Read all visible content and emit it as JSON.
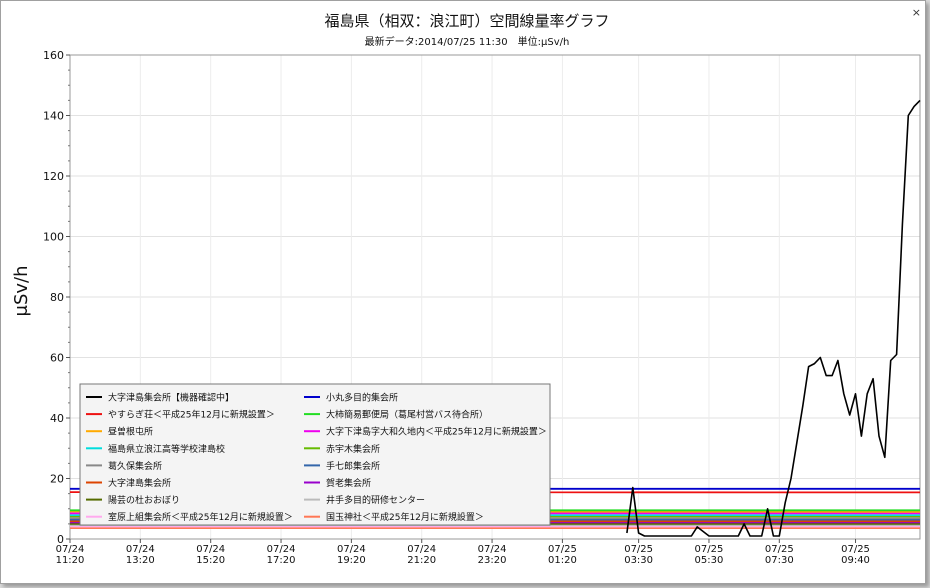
{
  "window": {
    "close_label": "×"
  },
  "chart_data": {
    "type": "line",
    "title": "福島県（相双：浪江町）空間線量率グラフ",
    "subtitle": "最新データ:2014/07/25 11:30　単位:μSv/h",
    "ylabel": "μSv/h",
    "ylim": [
      0,
      160
    ],
    "yticks": [
      0,
      20,
      40,
      60,
      80,
      100,
      120,
      140,
      160
    ],
    "xlim": [
      "07/24 11:20",
      "07/25 11:30"
    ],
    "xticks": [
      {
        "date": "07/24",
        "time": "11:20"
      },
      {
        "date": "07/24",
        "time": "13:20"
      },
      {
        "date": "07/24",
        "time": "15:20"
      },
      {
        "date": "07/24",
        "time": "17:20"
      },
      {
        "date": "07/24",
        "time": "19:20"
      },
      {
        "date": "07/24",
        "time": "21:20"
      },
      {
        "date": "07/24",
        "time": "23:20"
      },
      {
        "date": "07/25",
        "time": "01:20"
      },
      {
        "date": "07/25",
        "time": "03:30"
      },
      {
        "date": "07/25",
        "time": "05:30"
      },
      {
        "date": "07/25",
        "time": "07:30"
      },
      {
        "date": "07/25",
        "time": "09:40"
      }
    ],
    "grid": true,
    "legend_position": "bottom-left",
    "series": [
      {
        "name": "大字津島集会所【機器確認中】",
        "color": "#000000",
        "x": [
          "07/24 11:20",
          "07/25 02:40",
          "07/25 03:10",
          "07/25 03:20",
          "07/25 03:30",
          "07/25 03:40",
          "07/25 04:00",
          "07/25 04:40",
          "07/25 05:00",
          "07/25 05:10",
          "07/25 05:30",
          "07/25 06:00",
          "07/25 06:20",
          "07/25 06:30",
          "07/25 06:40",
          "07/25 07:00",
          "07/25 07:10",
          "07/25 07:20",
          "07/25 07:30",
          "07/25 07:40",
          "07/25 07:50",
          "07/25 08:00",
          "07/25 08:10",
          "07/25 08:20",
          "07/25 08:30",
          "07/25 08:40",
          "07/25 08:50",
          "07/25 09:00",
          "07/25 09:10",
          "07/25 09:20",
          "07/25 09:30",
          "07/25 09:40",
          "07/25 09:50",
          "07/25 10:00",
          "07/25 10:10",
          "07/25 10:20",
          "07/25 10:30",
          "07/25 10:40",
          "07/25 10:50",
          "07/25 11:00",
          "07/25 11:10",
          "07/25 11:20",
          "07/25 11:30"
        ],
        "values": [
          null,
          null,
          2,
          17,
          2,
          1,
          1,
          1,
          1,
          4,
          1,
          1,
          1,
          5,
          1,
          1,
          10,
          1,
          1,
          12,
          20,
          32,
          44,
          57,
          58,
          60,
          54,
          54,
          59,
          48,
          41,
          48,
          34,
          48,
          53,
          34,
          27,
          59,
          61,
          104,
          140,
          143,
          145
        ]
      },
      {
        "name": "小丸多目的集会所",
        "color": "#0000cc",
        "x": [
          "07/24 11:20",
          "07/25 11:30"
        ],
        "values": [
          16.6,
          16.6
        ]
      },
      {
        "name": "やすらぎ荘＜平成25年12月に新規設置＞",
        "color": "#ee1111",
        "x": [
          "07/24 11:20",
          "07/25 11:30"
        ],
        "values": [
          15.5,
          15.4
        ]
      },
      {
        "name": "大柿簡易郵便局（葛尾村営バス待合所）",
        "color": "#22dd22",
        "x": [
          "07/24 11:20",
          "07/25 11:30"
        ],
        "values": [
          9.5,
          9.5
        ]
      },
      {
        "name": "昼曽根屯所",
        "color": "#ffaa00",
        "x": [
          "07/24 11:20",
          "07/25 11:30"
        ],
        "values": [
          9.1,
          9.0
        ]
      },
      {
        "name": "大字下津島字大和久地内＜平成25年12月に新規設置＞",
        "color": "#ee00ee",
        "x": [
          "07/24 11:20",
          "07/25 11:30"
        ],
        "values": [
          8.5,
          8.5
        ]
      },
      {
        "name": "福島県立浪江高等学校津島校",
        "color": "#00dddd",
        "x": [
          "07/24 11:20",
          "07/25 11:30"
        ],
        "values": [
          7.9,
          7.9
        ]
      },
      {
        "name": "赤宇木集会所",
        "color": "#66bb00",
        "x": [
          "07/24 11:20",
          "07/25 11:30"
        ],
        "values": [
          7.5,
          7.5
        ]
      },
      {
        "name": "葛久保集会所",
        "color": "#888888",
        "x": [
          "07/24 11:20",
          "07/25 11:30"
        ],
        "values": [
          6.9,
          6.9
        ]
      },
      {
        "name": "手七郎集会所",
        "color": "#3366aa",
        "x": [
          "07/24 11:20",
          "07/25 11:30"
        ],
        "values": [
          6.4,
          6.4
        ]
      },
      {
        "name": "大字津島集会所",
        "color": "#dd4400",
        "x": [
          "07/24 11:20",
          "07/25 11:30"
        ],
        "values": [
          5.9,
          5.9
        ]
      },
      {
        "name": "賀老集会所",
        "color": "#9900cc",
        "x": [
          "07/24 11:20",
          "07/25 11:30"
        ],
        "values": [
          5.5,
          5.5
        ]
      },
      {
        "name": "陽芸の杜おおぼり",
        "color": "#556b00",
        "x": [
          "07/24 11:20",
          "07/25 11:30"
        ],
        "values": [
          5.0,
          5.0
        ]
      },
      {
        "name": "井手多目的研修センター",
        "color": "#bbbbbb",
        "x": [
          "07/24 11:20",
          "07/25 11:30"
        ],
        "values": [
          4.6,
          4.6
        ]
      },
      {
        "name": "室原上組集会所＜平成25年12月に新規設置＞",
        "color": "#ffaaee",
        "x": [
          "07/24 11:20",
          "07/25 11:30"
        ],
        "values": [
          4.2,
          4.2
        ]
      },
      {
        "name": "国玉神社＜平成25年12月に新規設置＞",
        "color": "#ff7755",
        "x": [
          "07/24 11:20",
          "07/25 11:30"
        ],
        "values": [
          3.6,
          3.6
        ]
      }
    ]
  }
}
